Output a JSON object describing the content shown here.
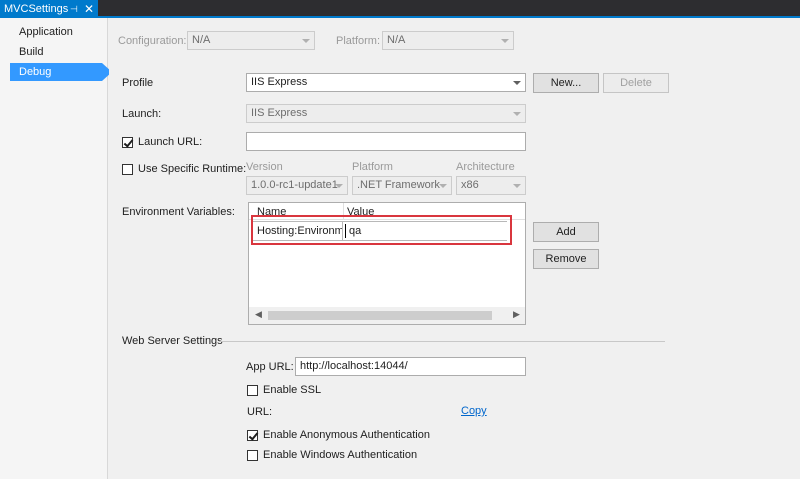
{
  "tab": {
    "title": "MVCSettings",
    "pin_icon": "pin-icon",
    "close_icon": "close-icon"
  },
  "nav": {
    "items": [
      {
        "label": "Application"
      },
      {
        "label": "Build"
      },
      {
        "label": "Debug",
        "selected": true
      }
    ]
  },
  "config": {
    "configuration_label": "Configuration:",
    "configuration_value": "N/A",
    "platform_label": "Platform:",
    "platform_value": "N/A"
  },
  "profile": {
    "label": "Profile",
    "value": "IIS Express",
    "new_label": "New...",
    "delete_label": "Delete"
  },
  "launch": {
    "label": "Launch:",
    "value": "IIS Express"
  },
  "launch_url": {
    "label": "Launch URL:",
    "checked": true,
    "value": ""
  },
  "runtime": {
    "label": "Use Specific Runtime:",
    "checked": false,
    "version_label": "Version",
    "version_value": "1.0.0-rc1-update1",
    "platform_label": "Platform",
    "platform_value": ".NET Framework",
    "arch_label": "Architecture",
    "arch_value": "x86"
  },
  "env": {
    "label": "Environment Variables:",
    "col_name": "Name",
    "col_value": "Value",
    "rows": [
      {
        "name": "Hosting:Environment",
        "value": "qa"
      }
    ],
    "add_label": "Add",
    "remove_label": "Remove"
  },
  "webserver": {
    "label": "Web Server Settings",
    "app_url_label": "App URL:",
    "app_url_value": "http://localhost:14044/",
    "enable_ssl_label": "Enable SSL",
    "enable_ssl_checked": false,
    "url_label": "URL:",
    "copy_label": "Copy",
    "anon_auth_label": "Enable Anonymous Authentication",
    "anon_auth_checked": true,
    "win_auth_label": "Enable Windows Authentication",
    "win_auth_checked": false
  },
  "colors": {
    "accent": "#007acc",
    "nav_selected": "#3399ff",
    "highlight_border": "#d9363e",
    "link": "#0066cc"
  }
}
